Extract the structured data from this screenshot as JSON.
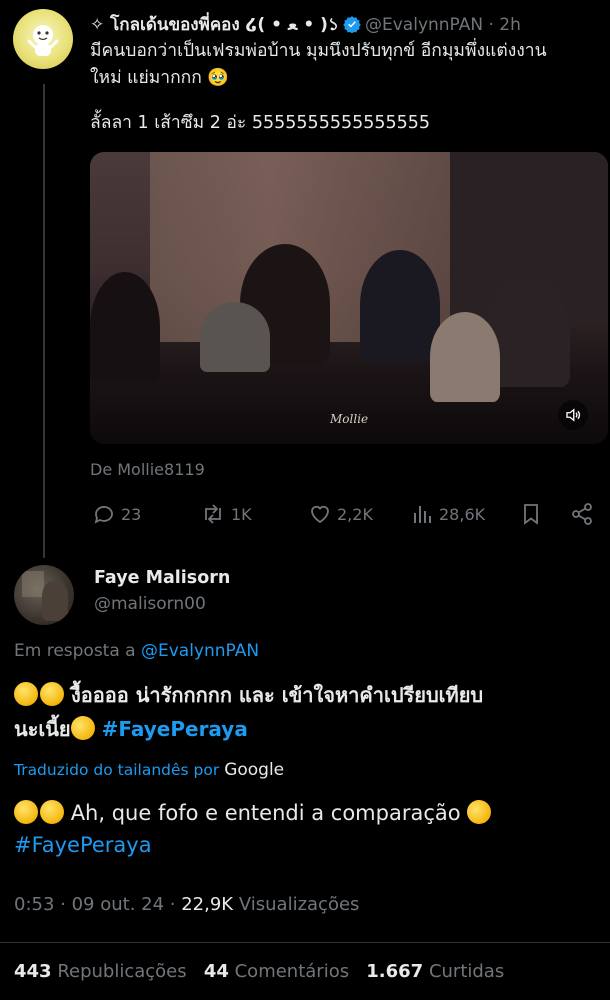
{
  "parent": {
    "name": "✧ โกลเด้นของพี่คอง ໒( • ﻌ • )১",
    "handle": "@EvalynnPAN",
    "time": "· 2h",
    "text_line1": "มีคนบอกว่าเป็นเฟรมพ่อบ้าน มุมนึงปรับทุกข์ อีกมุมพึ่งแต่งงาน",
    "text_line2": "ใหม่ แย่มากกก 🥹",
    "text_line3": "ลั้ลลา 1 เส้าซึม 2 อ่ะ 5555555555555555",
    "media_watermark": "Mollie",
    "source": "De Mollie8119",
    "actions": {
      "replies": "23",
      "reposts": "1K",
      "likes": "2,2K",
      "views": "28,6K"
    }
  },
  "reply": {
    "name": "Faye Malisorn",
    "handle": "@malisorn00",
    "reply_label": "Em resposta a",
    "reply_to": "@EvalynnPAN",
    "text_main": "งื้ออออ น่ารักกกกก และ เข้าใจหาคำเปรียบเทียบ",
    "text_main2": "นะเนี้ย",
    "hashtag": "#FayePeraya",
    "translated_label": "Traduzido do tailandês por",
    "translated_brand": "Google",
    "translation": "Ah, que fofo e entendi a comparação",
    "meta_time": "0:53 · 09 out. 24 ·",
    "meta_views": "22,9K",
    "meta_views_label": "Visualizações",
    "stats": {
      "reposts_count": "443",
      "reposts_label": "Republicações",
      "comments_count": "44",
      "comments_label": "Comentários",
      "likes_count": "1.667",
      "likes_label": "Curtidas"
    }
  },
  "colors": {
    "background": "#000000",
    "text": "#e7e9ea",
    "muted": "#71767b",
    "accent": "#1d9bf0"
  }
}
